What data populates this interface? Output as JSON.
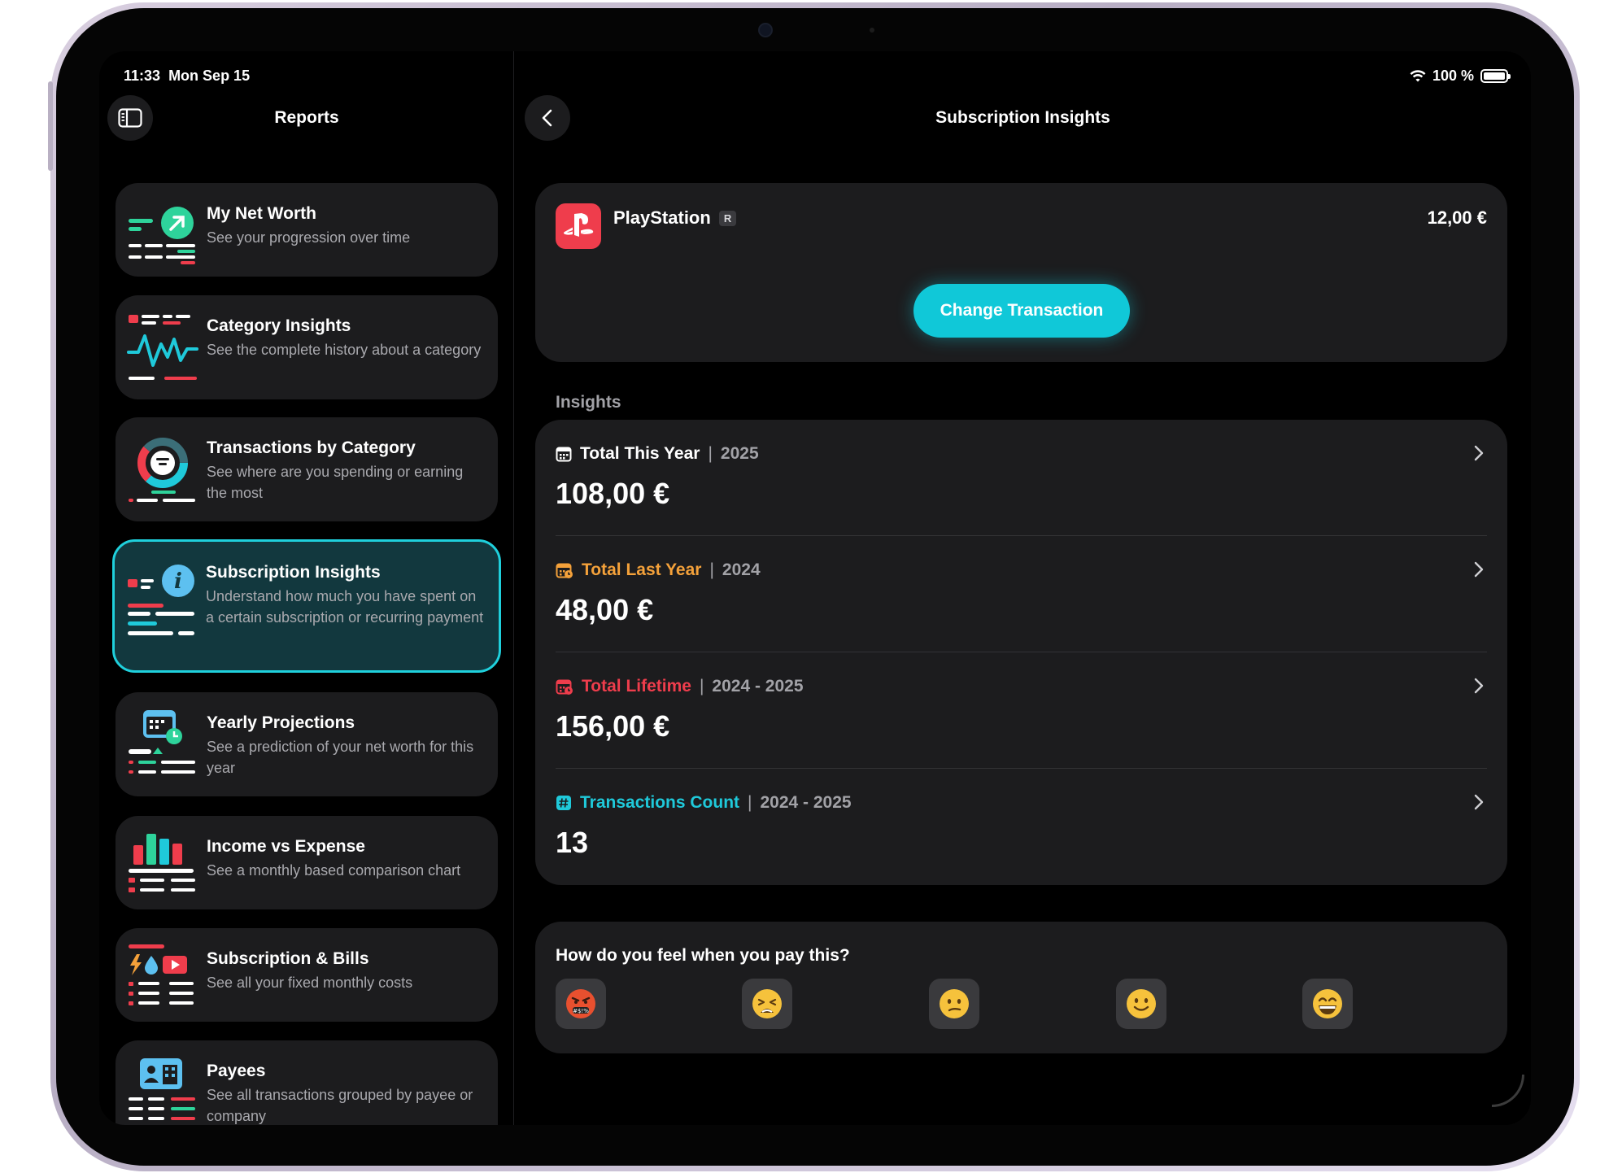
{
  "status_bar": {
    "time": "11:33",
    "date": "Mon Sep 15",
    "battery": "100 %"
  },
  "sidebar": {
    "title": "Reports",
    "items": [
      {
        "title": "My Net Worth",
        "desc": "See your progression over time",
        "icon": "net-worth-icon"
      },
      {
        "title": "Category Insights",
        "desc": "See the complete history about a category",
        "icon": "category-insights-icon"
      },
      {
        "title": "Transactions by Category",
        "desc": "See where are you spending or earning the most",
        "icon": "donut-chart-icon"
      },
      {
        "title": "Subscription Insights",
        "desc": "Understand how much you have spent on a certain subscription or recurring payment",
        "icon": "info-icon"
      },
      {
        "title": "Yearly Projections",
        "desc": "See a prediction of your net worth for this year",
        "icon": "calendar-clock-icon"
      },
      {
        "title": "Income vs Expense",
        "desc": "See a monthly based comparison chart",
        "icon": "bar-chart-icon"
      },
      {
        "title": "Subscription & Bills",
        "desc": "See all your fixed monthly costs",
        "icon": "bills-icon"
      },
      {
        "title": "Payees",
        "desc": "See all transactions grouped by payee or company",
        "icon": "building-icon"
      }
    ]
  },
  "main": {
    "title": "Subscription Insights",
    "payee": {
      "name": "PlayStation",
      "badge": "R",
      "amount": "12,00 €",
      "logo": "playstation-logo",
      "color": "#ef3d4c"
    },
    "change_button": "Change Transaction",
    "insights_label": "Insights",
    "insights": [
      {
        "label": "Total This Year",
        "period": "2025",
        "value": "108,00 €",
        "color": "#ffffff",
        "icon": "calendar-icon"
      },
      {
        "label": "Total Last Year",
        "period": "2024",
        "value": "48,00 €",
        "color": "#f4a13a",
        "icon": "calendar-icon"
      },
      {
        "label": "Total Lifetime",
        "period": "2024 - 2025",
        "value": "156,00 €",
        "color": "#ef3d4c",
        "icon": "calendar-icon"
      },
      {
        "label": "Transactions Count",
        "period": "2024 - 2025",
        "value": "13",
        "color": "#1fc9da",
        "icon": "hashtag-icon"
      }
    ],
    "mood": {
      "question": "How do you feel when you pay this?",
      "options": [
        "angry-face-icon",
        "tired-face-icon",
        "confused-face-icon",
        "slight-smile-icon",
        "grin-face-icon"
      ]
    }
  },
  "colors": {
    "accent": "#10c8d8",
    "card": "#1c1c1e",
    "active_card": "#12383e",
    "red": "#ef3d4c",
    "orange": "#f4a13a",
    "green": "#2ed39b"
  }
}
